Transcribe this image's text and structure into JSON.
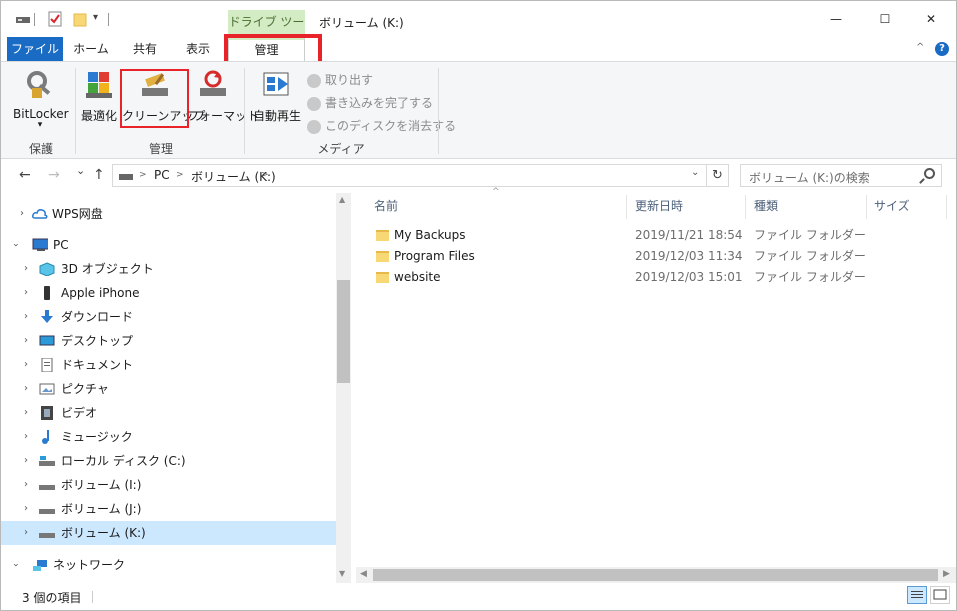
{
  "title_bar": {
    "context_tab": "ドライブ ツール",
    "window_title": "ボリューム (K:)",
    "minimize_glyph": "—",
    "maximize_glyph": "☐",
    "close_glyph": "✕"
  },
  "ribbon_tabs": {
    "file": "ファイル",
    "home": "ホーム",
    "share": "共有",
    "view": "表示",
    "manage": "管理",
    "collapse_glyph": "^",
    "help_glyph": "?"
  },
  "ribbon": {
    "bitlocker": "BitLocker",
    "bitlocker_dropdown": "▾",
    "optimize": "最適化",
    "cleanup": "クリーンアップ",
    "format": "フォーマット",
    "autoplay": "自動再生",
    "eject": "取り出す",
    "finish_burning": "書き込みを完了する",
    "erase_disc": "このディスクを消去する",
    "group_protect": "保護",
    "group_manage": "管理",
    "group_media": "メディア"
  },
  "address_bar": {
    "back_glyph": "←",
    "forward_glyph": "→",
    "recent_glyph": "⌄",
    "up_glyph": "↑",
    "crumbs": [
      "PC",
      "ボリューム (K:)"
    ],
    "separator": ">",
    "refresh_glyph": "↻",
    "search_placeholder": "ボリューム (K:)の検索"
  },
  "nav_pane": {
    "items": [
      {
        "label": "WPS网盘",
        "icon": "cloud-icon"
      },
      {
        "label": "PC",
        "icon": "computer-icon"
      },
      {
        "label": "3D オブジェクト",
        "icon": "3d-objects-icon"
      },
      {
        "label": "Apple iPhone",
        "icon": "iphone-icon"
      },
      {
        "label": "ダウンロード",
        "icon": "download-icon"
      },
      {
        "label": "デスクトップ",
        "icon": "desktop-icon"
      },
      {
        "label": "ドキュメント",
        "icon": "document-icon"
      },
      {
        "label": "ピクチャ",
        "icon": "picture-icon"
      },
      {
        "label": "ビデオ",
        "icon": "video-icon"
      },
      {
        "label": "ミュージック",
        "icon": "music-icon"
      },
      {
        "label": "ローカル ディスク (C:)",
        "icon": "local-disk-icon"
      },
      {
        "label": "ボリューム (I:)",
        "icon": "drive-icon"
      },
      {
        "label": "ボリューム (J:)",
        "icon": "drive-icon"
      },
      {
        "label": "ボリューム (K:)",
        "icon": "drive-icon"
      },
      {
        "label": "ネットワーク",
        "icon": "network-icon"
      }
    ]
  },
  "file_list": {
    "columns": [
      "名前",
      "更新日時",
      "種類",
      "サイズ"
    ],
    "rows": [
      {
        "name": "My Backups",
        "date": "2019/11/21 18:54",
        "type": "ファイル フォルダー"
      },
      {
        "name": "Program Files",
        "date": "2019/12/03 11:34",
        "type": "ファイル フォルダー"
      },
      {
        "name": "website",
        "date": "2019/12/03 15:01",
        "type": "ファイル フォルダー"
      }
    ]
  },
  "status_bar": {
    "item_count": "3 個の項目"
  },
  "colors": {
    "file_tab_blue": "#1a6bc4",
    "context_tab_green": "#d3ecc4",
    "highlight_red": "#e8232a",
    "selection": "#cce8ff",
    "folder_yellow": "#f8d775"
  }
}
